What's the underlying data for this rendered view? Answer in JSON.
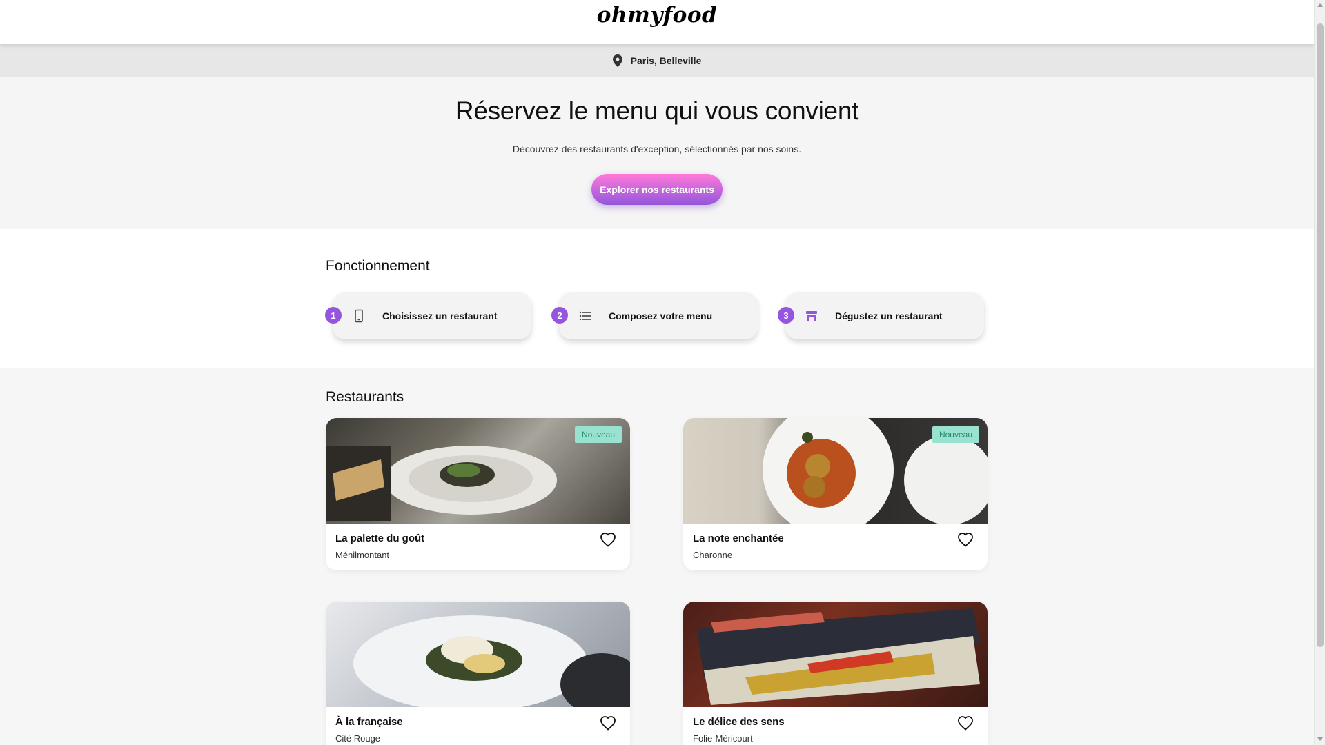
{
  "header": {
    "logo": "ohmyfood"
  },
  "location": {
    "text": "Paris, Belleville",
    "icon": "location-pin-icon"
  },
  "hero": {
    "title": "Réservez le menu qui vous convient",
    "subtitle": "Découvrez des restaurants d'exception, sélectionnés par nos soins.",
    "cta_label": "Explorer nos restaurants"
  },
  "how": {
    "title": "Fonctionnement",
    "steps": [
      {
        "num": "1",
        "label": "Choisissez un restaurant",
        "icon": "smartphone-icon"
      },
      {
        "num": "2",
        "label": "Composez votre menu",
        "icon": "list-icon"
      },
      {
        "num": "3",
        "label": "Dégustez un restaurant",
        "icon": "store-icon"
      }
    ]
  },
  "restaurants": {
    "title": "Restaurants",
    "items": [
      {
        "name": "La palette du goût",
        "area": "Ménilmontant",
        "badge": "Nouveau"
      },
      {
        "name": "La note enchantée",
        "area": "Charonne",
        "badge": "Nouveau"
      },
      {
        "name": "À la française",
        "area": "Cité Rouge",
        "badge": ""
      },
      {
        "name": "Le délice des sens",
        "area": "Folie-Méricourt",
        "badge": ""
      }
    ]
  },
  "colors": {
    "accent": "#9356dc",
    "accent_light": "#ff79da",
    "badge_bg": "#99e2d0",
    "badge_text": "#2a8a70"
  }
}
